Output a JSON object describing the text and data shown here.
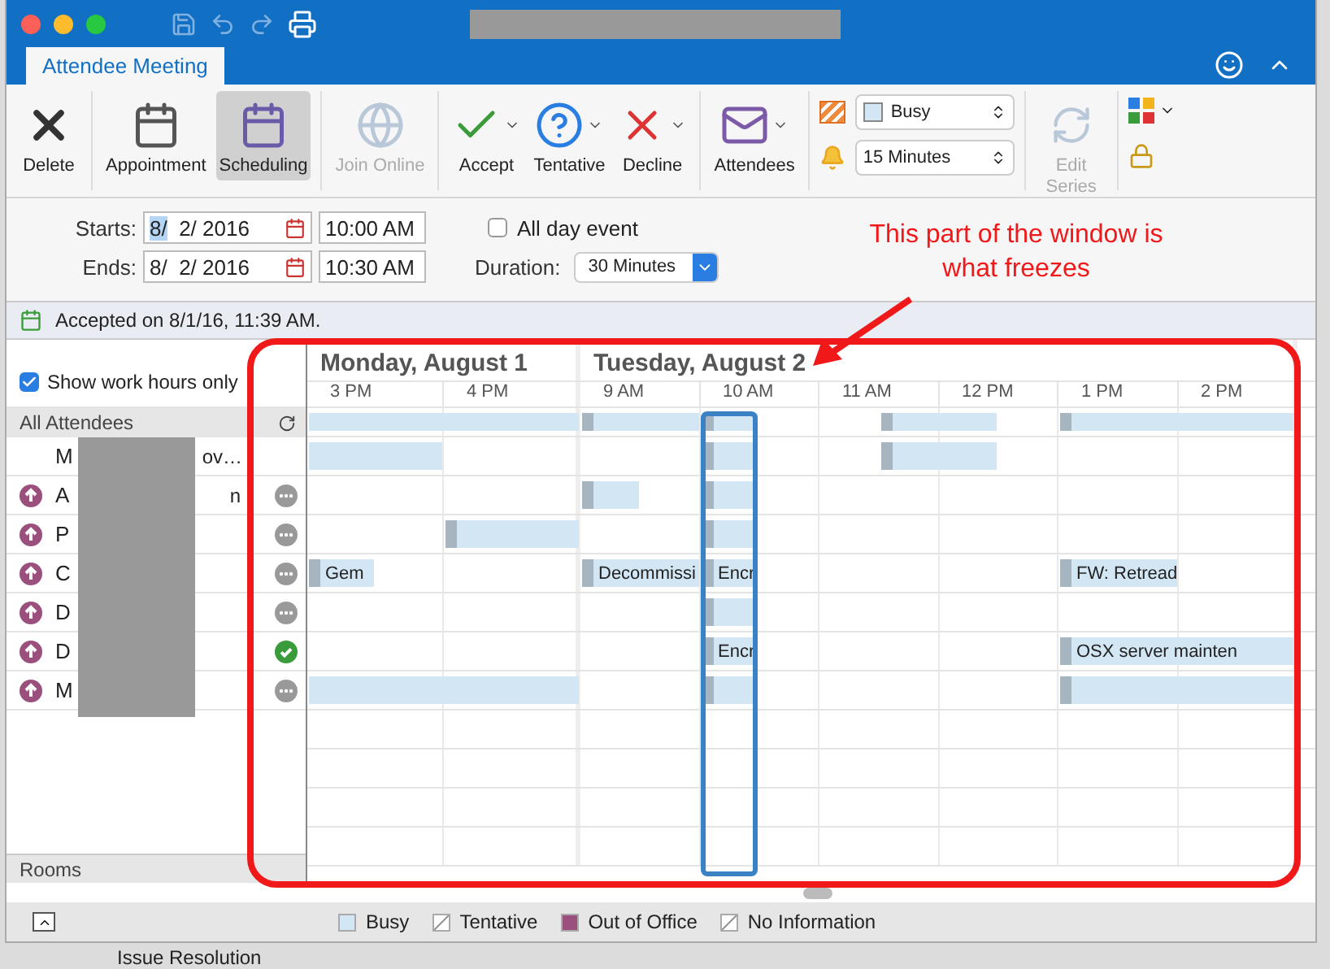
{
  "tabs": [
    {
      "label": "Attendee Meeting",
      "selected": true
    }
  ],
  "ribbon": {
    "groups": [
      [
        {
          "label": "Delete",
          "kind": "delete",
          "disabled": false,
          "selected": false,
          "has_menu": false
        }
      ],
      [
        {
          "label": "Appointment",
          "kind": "appointment",
          "disabled": false,
          "selected": false,
          "has_menu": false
        },
        {
          "label": "Scheduling",
          "kind": "scheduling",
          "disabled": false,
          "selected": true,
          "has_menu": false
        }
      ],
      [
        {
          "label": "Join Online",
          "kind": "online",
          "disabled": true,
          "selected": false,
          "has_menu": false
        }
      ],
      [
        {
          "label": "Accept",
          "kind": "accept",
          "disabled": false,
          "selected": false,
          "has_menu": true
        },
        {
          "label": "Tentative",
          "kind": "tentative",
          "disabled": false,
          "selected": false,
          "has_menu": true
        },
        {
          "label": "Decline",
          "kind": "decline",
          "disabled": false,
          "selected": false,
          "has_menu": true
        }
      ],
      [
        {
          "label": "Attendees",
          "kind": "attendees",
          "disabled": false,
          "selected": false,
          "has_menu": true
        }
      ]
    ],
    "show_as": {
      "value": "Busy"
    },
    "reminder": {
      "value": "15 Minutes"
    },
    "edit_series": {
      "label": "Edit Series",
      "disabled": true
    }
  },
  "form": {
    "starts": {
      "label": "Starts:",
      "month": "8/",
      "rest": "  2/ 2016",
      "month_selected": true,
      "time": "10:00 AM"
    },
    "ends": {
      "label": "Ends:",
      "month": "8/",
      "rest": "  2/ 2016",
      "month_selected": false,
      "time": "10:30 AM"
    },
    "all_day": {
      "label": "All day event",
      "checked": false
    },
    "duration": {
      "label": "Duration:",
      "value": "30 Minutes"
    }
  },
  "info_bar": {
    "text": "Accepted on 8/1/16, 11:39 AM."
  },
  "scheduling": {
    "show_work_hours": {
      "label": "Show work hours only",
      "checked": true
    },
    "all_attendees_label": "All Attendees",
    "days": [
      {
        "label": "Monday, August 1",
        "hours": [
          "3 PM",
          "4 PM"
        ]
      },
      {
        "label": "Tuesday, August 2",
        "hours": [
          "9 AM",
          "10 AM",
          "11 AM",
          "12 PM",
          "1 PM",
          "2 PM"
        ]
      }
    ],
    "attendees": [
      {
        "name_start": "M",
        "name_end": "ov…",
        "kind": "organizer"
      },
      {
        "name_start": "A",
        "name_end": "n",
        "kind": "pending"
      },
      {
        "name_start": "P",
        "kind": "pending"
      },
      {
        "name_start": "C",
        "kind": "pending",
        "events": [
          {
            "label": "Gem"
          },
          {
            "label": "Decommissi"
          },
          {
            "label": "Encr"
          },
          {
            "label": "FW: Retread"
          }
        ]
      },
      {
        "name_start": "D",
        "kind": "pending"
      },
      {
        "name_start": "D",
        "kind": "accepted",
        "events": [
          {
            "label": "Encr"
          },
          {
            "label": "OSX server mainten"
          }
        ]
      },
      {
        "name_start": "M",
        "kind": "pending"
      }
    ],
    "rooms_label": "Rooms"
  },
  "legend": [
    {
      "label": "Busy",
      "kind": "busy"
    },
    {
      "label": "Tentative",
      "kind": "tentative"
    },
    {
      "label": "Out of Office",
      "kind": "oof"
    },
    {
      "label": "No Information",
      "kind": "noinfo"
    }
  ],
  "annotation": {
    "text": "This part of the window is what freezes"
  },
  "background": {
    "text": "Issue Resolution"
  }
}
